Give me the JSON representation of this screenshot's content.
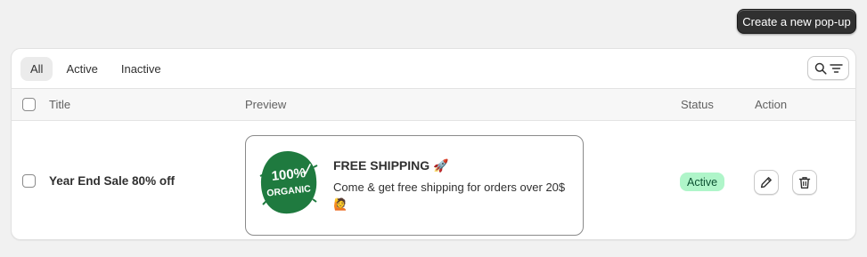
{
  "header": {
    "create_button": "Create a new pop-up"
  },
  "tabs": [
    {
      "label": "All",
      "selected": true
    },
    {
      "label": "Active",
      "selected": false
    },
    {
      "label": "Inactive",
      "selected": false
    }
  ],
  "filter": {
    "icons": [
      "search-icon",
      "filter-lines-icon"
    ]
  },
  "table": {
    "columns": {
      "title": "Title",
      "preview": "Preview",
      "status": "Status",
      "action": "Action"
    },
    "rows": [
      {
        "title": "Year End Sale 80% off",
        "preview": {
          "logo_line1": "100%",
          "logo_line2": "ORGANIC",
          "heading": "FREE SHIPPING 🚀",
          "description": "Come & get free shipping for orders over 20$ 🙋"
        },
        "status": "Active",
        "actions": [
          "pencil-icon",
          "trash-icon"
        ]
      }
    ]
  },
  "colors": {
    "primary_button": "#303030",
    "status_active_bg": "#aff5c9",
    "status_active_text": "#0c5132",
    "logo_green": "#1f7a3f"
  }
}
